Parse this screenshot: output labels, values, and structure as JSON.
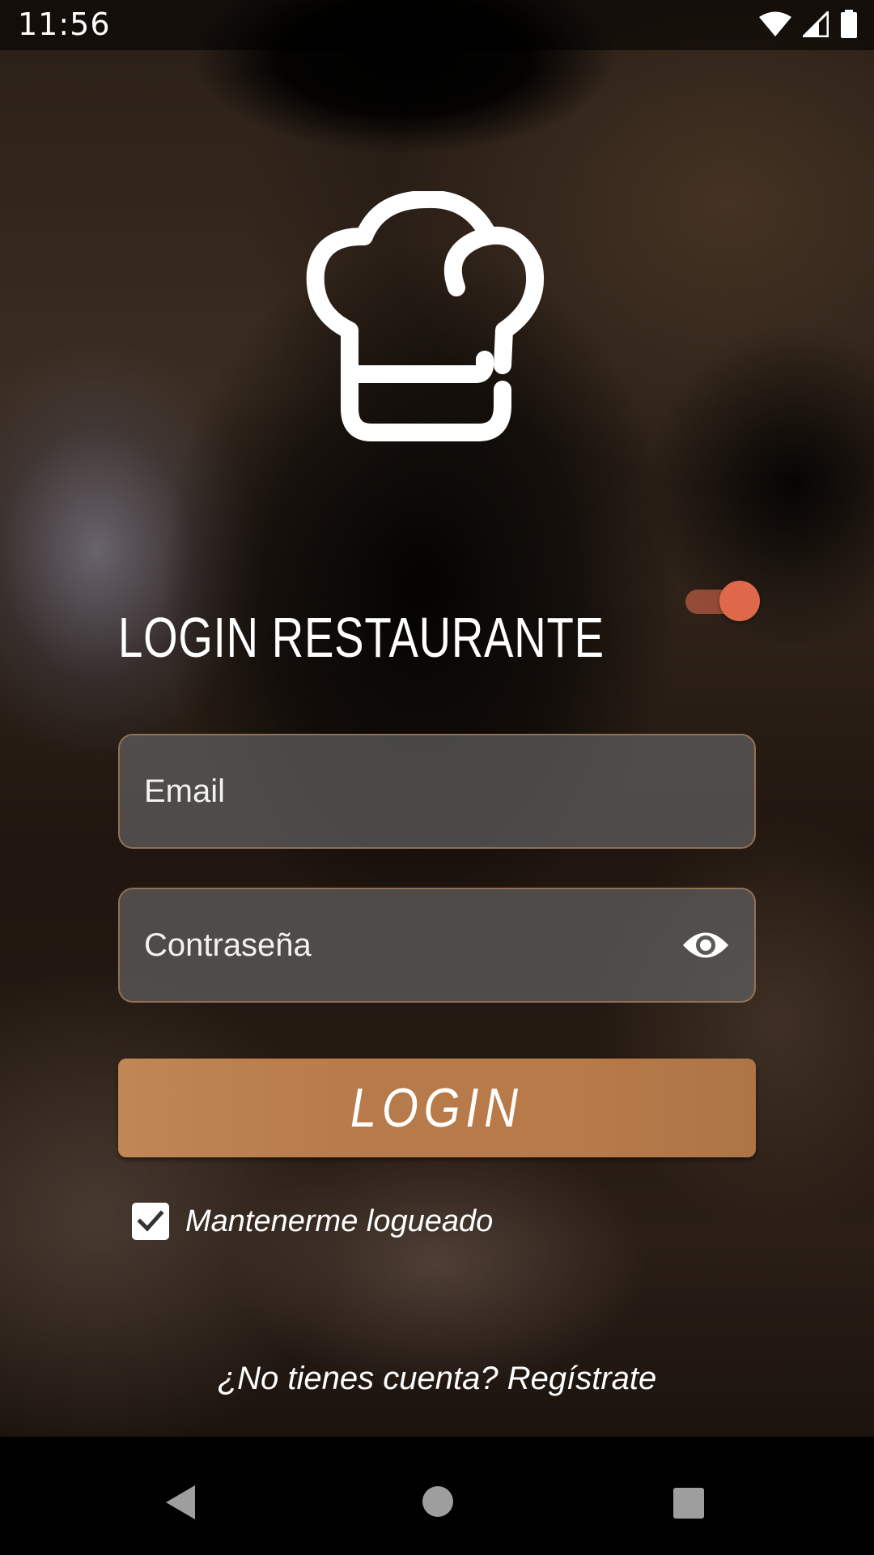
{
  "status_bar": {
    "time": "11:56",
    "icons": [
      "wifi-icon",
      "cell-signal-icon",
      "battery-icon"
    ]
  },
  "header": {
    "logo_icon": "chef-hat-icon",
    "title": "LOGIN RESTAURANTE",
    "toggle_state": "on",
    "toggle_color": "#e0684a"
  },
  "form": {
    "email": {
      "placeholder": "Email",
      "value": ""
    },
    "password": {
      "placeholder": "Contraseña",
      "value": "",
      "visibility_icon": "eye-icon"
    },
    "login_label": "LOGIN",
    "login_color": "#b87a48",
    "remember": {
      "label": "Mantenerme logueado",
      "checked": true
    },
    "register_text": "¿No tienes cuenta? Regístrate"
  },
  "nav_bar": {
    "icons": [
      "back-icon",
      "home-icon",
      "recents-icon"
    ]
  }
}
